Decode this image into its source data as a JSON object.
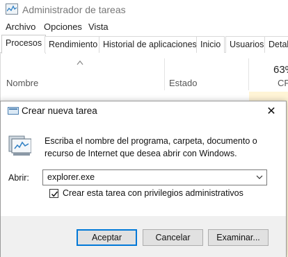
{
  "task_manager": {
    "title": "Administrador de tareas",
    "menu": [
      "Archivo",
      "Opciones",
      "Vista"
    ],
    "tabs": [
      "Procesos",
      "Rendimiento",
      "Historial de aplicaciones",
      "Inicio",
      "Usuarios",
      "Detal"
    ],
    "active_tab": "Procesos",
    "columns": {
      "name": "Nombre",
      "status": "Estado",
      "cpu_percent": "63%",
      "cpu": "CPU"
    }
  },
  "dialog": {
    "title": "Crear nueva tarea",
    "close_glyph": "✕",
    "description_line1": "Escriba el nombre del programa, carpeta, documento o",
    "description_line2": "recurso de Internet que desea abrir con Windows.",
    "open_label": "Abrir:",
    "open_value": "explorer.exe",
    "checkbox_label": "Crear esta tarea con privilegios administrativos",
    "checkbox_checked": true,
    "buttons": {
      "ok": "Aceptar",
      "cancel": "Cancelar",
      "browse": "Examinar..."
    }
  },
  "colors": {
    "accent": "#0078d7",
    "cpu_highlight": "#fff4d6"
  }
}
